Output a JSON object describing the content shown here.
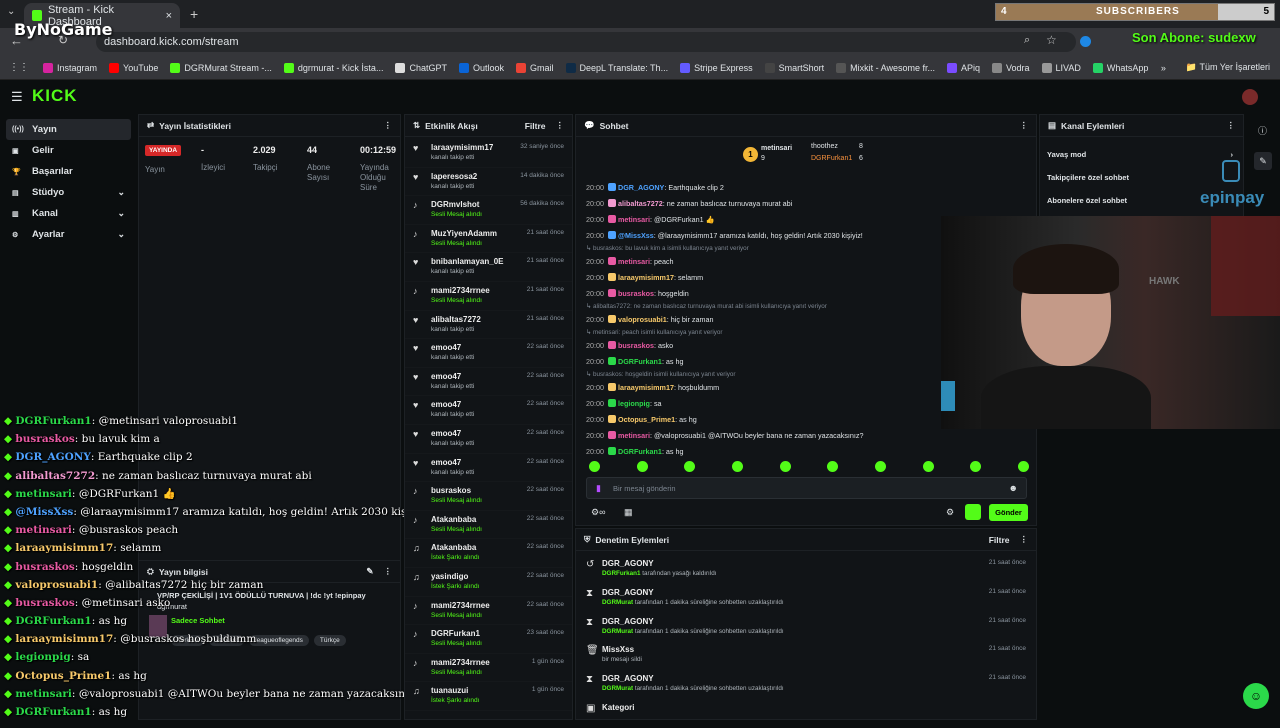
{
  "browser": {
    "tab_title": "Stream - Kick Dashboard",
    "url": "dashboard.kick.com/stream",
    "bookmarks": [
      {
        "label": "Instagram",
        "color": "#d6249f"
      },
      {
        "label": "YouTube",
        "color": "#ff0000"
      },
      {
        "label": "DGRMurat Stream -...",
        "color": "#53fc18"
      },
      {
        "label": "dgrmurat - Kick İsta...",
        "color": "#53fc18"
      },
      {
        "label": "ChatGPT",
        "color": "#dddddd"
      },
      {
        "label": "Outlook",
        "color": "#0a64d6"
      },
      {
        "label": "Gmail",
        "color": "#ea4335"
      },
      {
        "label": "DeepL Translate: Th...",
        "color": "#0f2b46"
      },
      {
        "label": "Stripe Express",
        "color": "#635bff"
      },
      {
        "label": "SmartShort",
        "color": "#444444"
      },
      {
        "label": "Mixkit - Awesome fr...",
        "color": "#555555"
      },
      {
        "label": "APiq",
        "color": "#7a4cff"
      },
      {
        "label": "Vodra",
        "color": "#888888"
      },
      {
        "label": "LIVAD",
        "color": "#999999"
      },
      {
        "label": "WhatsApp",
        "color": "#25d366"
      }
    ],
    "all_bookmarks": "Tüm Yer İşaretleri"
  },
  "overlay": {
    "brand": "ByNoGame",
    "sub_count_left": "4",
    "sub_label": "SUBSCRIBERS",
    "sub_count_right": "5",
    "last_sub": "Son Abone: sudexw",
    "chat": [
      {
        "user": "DGRFurkan1",
        "msg": "@metinsari valoprosuabi1",
        "color": "#2bd94a"
      },
      {
        "user": "busraskos",
        "msg": "bu lavuk kim a",
        "color": "#e85aa3"
      },
      {
        "user": "DGR_AGONY",
        "msg": "Earthquake clip 2",
        "color": "#4ea2ff"
      },
      {
        "user": "alibaltas7272",
        "msg": "ne zaman baslıcaz turnuvaya murat abi",
        "color": "#f29ad0"
      },
      {
        "user": "metinsari",
        "msg": "@DGRFurkan1 👍",
        "color": "#2bd94a"
      },
      {
        "user": "@MissXss",
        "msg": "@laraaymisimm17 aramıza katıldı, hoş geldin! Artık 2030 kişiyiz!",
        "color": "#4ea2ff"
      },
      {
        "user": "metinsari",
        "msg": "@busraskos peach",
        "color": "#e85aa3"
      },
      {
        "user": "laraaymisimm17",
        "msg": "selamm",
        "color": "#f7c96b"
      },
      {
        "user": "busraskos",
        "msg": "hoşgeldin",
        "color": "#e85aa3"
      },
      {
        "user": "valoprosuabi1",
        "msg": "@alibaltas7272 hiç bir zaman",
        "color": "#f7c96b"
      },
      {
        "user": "busraskos",
        "msg": "@metinsari asko",
        "color": "#e85aa3"
      },
      {
        "user": "DGRFurkan1",
        "msg": "as hg",
        "color": "#2bd94a"
      },
      {
        "user": "laraaymisimm17",
        "msg": "@busraskos hoşbuldumm",
        "color": "#f7c96b"
      },
      {
        "user": "legionpig",
        "msg": "sa",
        "color": "#2bd94a"
      },
      {
        "user": "Octopus_Prime1",
        "msg": "as hg",
        "color": "#f7c96b"
      },
      {
        "user": "metinsari",
        "msg": "@valoprosuabi1 @AITWOu beyler bana ne zaman yazacaksınız?",
        "color": "#2bd94a"
      },
      {
        "user": "DGRFurkan1",
        "msg": "as hg",
        "color": "#2bd94a"
      }
    ],
    "epinpay": "epinpay"
  },
  "sidebar": {
    "items": [
      {
        "label": "Yayın",
        "icon": "broadcast-icon",
        "chev": ""
      },
      {
        "label": "Gelir",
        "icon": "dollar-icon",
        "chev": ""
      },
      {
        "label": "Başarılar",
        "icon": "trophy-icon",
        "chev": ""
      },
      {
        "label": "Stüdyo",
        "icon": "studio-icon",
        "chev": "⌄"
      },
      {
        "label": "Kanal",
        "icon": "channel-icon",
        "chev": "⌄"
      },
      {
        "label": "Ayarlar",
        "icon": "settings-icon",
        "chev": "⌄"
      }
    ]
  },
  "stats": {
    "title": "Yayın İstatistikleri",
    "live_badge": "YAYINDA",
    "live_label": "Yayın",
    "viewers": "-",
    "viewers_label": "İzleyici",
    "followers": "2.029",
    "followers_label": "Takipçi",
    "subs": "44",
    "subs_label": "Abone Sayısı",
    "uptime": "00:12:59",
    "uptime_label": "Yayında Olduğu Süre"
  },
  "stream_info": {
    "title": "Yayın bilgisi",
    "stream_title": "VP/RP ÇEKİLİŞİ | 1V1 ÖDÜLLÜ TURNUVA | !dc !yt !epinpay",
    "channel": "dgrmurat",
    "category": "Sadece Sohbet",
    "tags": [
      "Turkish",
      "valorant",
      "leagueoflegends",
      "Türkçe"
    ]
  },
  "activity": {
    "title": "Etkinlik Akışı",
    "filter": "Filtre",
    "items": [
      {
        "name": "laraaymisimm17",
        "sub": "kanalı takip etti",
        "time": "32 saniye önce",
        "type": "follow"
      },
      {
        "name": "laperesosa2",
        "sub": "kanalı takip etti",
        "time": "14 dakika önce",
        "type": "follow"
      },
      {
        "name": "DGRmvlshot",
        "sub": "Sesli Mesaj alındı",
        "time": "56 dakika önce",
        "type": "tts"
      },
      {
        "name": "MuzYiyenAdamm",
        "sub": "Sesli Mesaj alındı",
        "time": "21 saat önce",
        "type": "tts"
      },
      {
        "name": "bnibanlamayan_0E",
        "sub": "kanalı takip etti",
        "time": "21 saat önce",
        "type": "follow"
      },
      {
        "name": "mami2734rrnee",
        "sub": "Sesli Mesaj alındı",
        "time": "21 saat önce",
        "type": "tts"
      },
      {
        "name": "alibaltas7272",
        "sub": "kanalı takip etti",
        "time": "21 saat önce",
        "type": "follow"
      },
      {
        "name": "emoo47",
        "sub": "kanalı takip etti",
        "time": "22 saat önce",
        "type": "follow"
      },
      {
        "name": "emoo47",
        "sub": "kanalı takip etti",
        "time": "22 saat önce",
        "type": "follow"
      },
      {
        "name": "emoo47",
        "sub": "kanalı takip etti",
        "time": "22 saat önce",
        "type": "follow"
      },
      {
        "name": "emoo47",
        "sub": "kanalı takip etti",
        "time": "22 saat önce",
        "type": "follow"
      },
      {
        "name": "emoo47",
        "sub": "kanalı takip etti",
        "time": "22 saat önce",
        "type": "follow"
      },
      {
        "name": "busraskos",
        "sub": "Sesli Mesaj alındı",
        "time": "22 saat önce",
        "type": "tts"
      },
      {
        "name": "Atakanbaba",
        "sub": "Sesli Mesaj alındı",
        "time": "22 saat önce",
        "type": "tts"
      },
      {
        "name": "Atakanbaba",
        "sub": "İstek Şarkı alındı",
        "time": "22 saat önce",
        "type": "song"
      },
      {
        "name": "yasindigo",
        "sub": "İstek Şarkı alındı",
        "time": "22 saat önce",
        "type": "song"
      },
      {
        "name": "mami2734rrnee",
        "sub": "Sesli Mesaj alındı",
        "time": "22 saat önce",
        "type": "tts"
      },
      {
        "name": "DGRFurkan1",
        "sub": "Sesli Mesaj alındı",
        "time": "23 saat önce",
        "type": "tts"
      },
      {
        "name": "mami2734rrnee",
        "sub": "Sesli Mesaj alındı",
        "time": "1 gün önce",
        "type": "tts"
      },
      {
        "name": "tuanauzui",
        "sub": "İstek Şarkı alındı",
        "time": "1 gün önce",
        "type": "song"
      }
    ]
  },
  "chat": {
    "title": "Sohbet",
    "top_gifters": [
      {
        "name": "metinsari",
        "count": "9"
      },
      {
        "name": "thoothez",
        "count": "8"
      },
      {
        "name": "DGRFurkan1",
        "count": "6"
      }
    ],
    "lines": [
      {
        "kind": "msg",
        "time": "20:00",
        "user": "DGR_AGONY",
        "msg": ": Earthquake clip 2",
        "color": "#4ea2ff"
      },
      {
        "kind": "msg",
        "time": "20:00",
        "user": "alibaltas7272",
        "msg": ": ne zaman baslıcaz turnuvaya murat abi",
        "color": "#f29ad0"
      },
      {
        "kind": "msg",
        "time": "20:00",
        "user": "metinsari",
        "msg": ": @DGRFurkan1 👍",
        "color": "#e85aa3"
      },
      {
        "kind": "msg",
        "time": "20:00",
        "user": "@MissXss",
        "msg": ": @laraaymisimm17 aramıza katıldı, hoş geldin! Artık 2030 kişiyiz!",
        "color": "#4ea2ff"
      },
      {
        "kind": "sys",
        "text": "busraskos: bu lavuk kim a isimli kullanıcıya yanıt veriyor"
      },
      {
        "kind": "msg",
        "time": "20:00",
        "user": "metinsari",
        "msg": ": peach",
        "color": "#e85aa3"
      },
      {
        "kind": "msg",
        "time": "20:00",
        "user": "laraaymisimm17",
        "msg": ": selamm",
        "color": "#f7c96b"
      },
      {
        "kind": "msg",
        "time": "20:00",
        "user": "busraskos",
        "msg": ": hoşgeldin",
        "color": "#e85aa3"
      },
      {
        "kind": "sys",
        "text": "alibaltas7272: ne zaman baslıcaz turnuvaya murat abi isimli kullanıcıya yanıt veriyor"
      },
      {
        "kind": "msg",
        "time": "20:00",
        "user": "valoprosuabi1",
        "msg": ": hiç bir zaman",
        "color": "#f7c96b"
      },
      {
        "kind": "sys",
        "text": "metinsari: peach isimli kullanıcıya yanıt veriyor"
      },
      {
        "kind": "msg",
        "time": "20:00",
        "user": "busraskos",
        "msg": ": asko",
        "color": "#e85aa3"
      },
      {
        "kind": "msg",
        "time": "20:00",
        "user": "DGRFurkan1",
        "msg": ": as hg",
        "color": "#2bd94a"
      },
      {
        "kind": "sys",
        "text": "busraskos: hoşgeldin isimli kullanıcıya yanıt veriyor"
      },
      {
        "kind": "msg",
        "time": "20:00",
        "user": "laraaymisimm17",
        "msg": ": hoşbuldumm",
        "color": "#f7c96b"
      },
      {
        "kind": "msg",
        "time": "20:00",
        "user": "legionpig",
        "msg": ": sa",
        "color": "#2bd94a"
      },
      {
        "kind": "msg",
        "time": "20:00",
        "user": "Octopus_Prime1",
        "msg": ": as hg",
        "color": "#f7c96b"
      },
      {
        "kind": "msg",
        "time": "20:00",
        "user": "metinsari",
        "msg": ": @valoprosuabi1 @AITWOu beyler bana ne zaman yazacaksınız?",
        "color": "#e85aa3"
      },
      {
        "kind": "msg",
        "time": "20:00",
        "user": "DGRFurkan1",
        "msg": ": as hg",
        "color": "#2bd94a"
      }
    ],
    "placeholder": "Bir mesaj gönderin",
    "send": "Gönder"
  },
  "channel_actions": {
    "title": "Kanal Eylemleri",
    "items": [
      "Yavaş mod",
      "Takipçilere özel sohbet",
      "Abonelere özel sohbet"
    ]
  },
  "moderation": {
    "title": "Denetim Eylemleri",
    "filter": "Filtre",
    "items": [
      {
        "name": "DGR_AGONY",
        "sub_user": "DGRFurkan1",
        "sub": " tarafından yasağı kaldırıldı",
        "time": "21 saat önce",
        "icon": "unban-icon",
        "glyph": "↺"
      },
      {
        "name": "DGR_AGONY",
        "sub_user": "DGRMurat",
        "sub": " tarafından 1 dakika süreliğine sohbetten uzaklaştırıldı",
        "time": "21 saat önce",
        "icon": "timeout-icon",
        "glyph": "⧗"
      },
      {
        "name": "DGR_AGONY",
        "sub_user": "DGRMurat",
        "sub": " tarafından 1 dakika süreliğine sohbetten uzaklaştırıldı",
        "time": "21 saat önce",
        "icon": "timeout-icon",
        "glyph": "⧗"
      },
      {
        "name": "MissXss",
        "sub_user": "",
        "sub": "bir mesajı sildi",
        "time": "21 saat önce",
        "icon": "trash-icon",
        "glyph": "🗑"
      },
      {
        "name": "DGR_AGONY",
        "sub_user": "DGRMurat",
        "sub": " tarafından 1 dakika süreliğine sohbetten uzaklaştırıldı",
        "time": "21 saat önce",
        "icon": "timeout-icon",
        "glyph": "⧗"
      },
      {
        "name": "Kategori",
        "sub_user": "",
        "sub": "",
        "time": "",
        "icon": "category-icon",
        "glyph": "▣"
      }
    ]
  }
}
